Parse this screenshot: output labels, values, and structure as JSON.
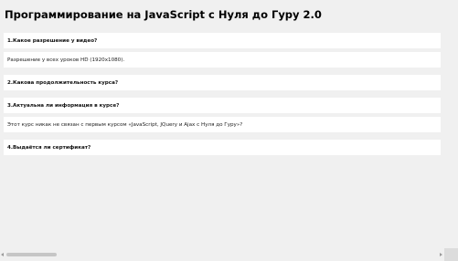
{
  "page": {
    "title": "Программирование на JavaScript с Нуля до Гуру 2.0"
  },
  "faq": [
    {
      "kind": "question",
      "text": "1.Какое разрешение у видео?"
    },
    {
      "kind": "answer",
      "text": "Разрешение у всех уроков HD (1920x1080)."
    },
    {
      "kind": "question",
      "text": "2.Какова продолжительность курса?"
    },
    {
      "kind": "question",
      "text": "3.Актуальна ли информация в курсе?"
    },
    {
      "kind": "answer",
      "text": "Этот курс никак не связан с первым курсом «JavaScript, JQuery и Ajax с Нуля до Гуру»?"
    },
    {
      "kind": "question",
      "text": "4.Выдаётся ли сертификат?"
    }
  ]
}
